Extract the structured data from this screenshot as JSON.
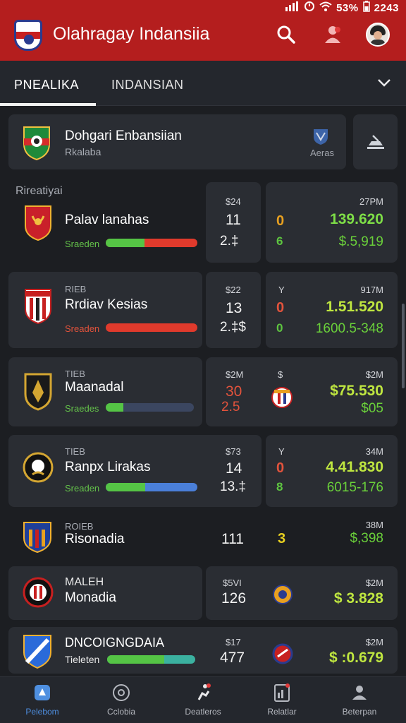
{
  "status_bar": {
    "battery": "53%",
    "time": "2243"
  },
  "app": {
    "title": "Olahragay Indansiia"
  },
  "tabs": [
    {
      "label": "PNEALIKA"
    },
    {
      "label": "INDANSIAN"
    }
  ],
  "featured": {
    "title": "Dohgari Enbansiian",
    "subtitle": "Rkalaba",
    "badge_label": "Aeras"
  },
  "section_label": "Rireatiyai",
  "rows": [
    {
      "name": "Palav lanahas",
      "small": "",
      "bar_label": "Sraeden",
      "bar": [
        0.42,
        0.58
      ],
      "count_top": "$24",
      "count": "11",
      "count_bottom": "2.‡",
      "mid_top": "",
      "mid_icon": "0",
      "mid_bottom": "6",
      "val_top": "27PM",
      "value": "139.620",
      "value2": "$.5,919"
    },
    {
      "name": "Rrdiav Kesias",
      "small": "RIEB",
      "bar_label": "Sreaden",
      "bar": [
        0.0,
        1.0
      ],
      "count_top": "$22",
      "count": "13",
      "count_bottom": "2.‡$",
      "mid_top": "Y",
      "mid_icon": "0",
      "mid_bottom": "0",
      "val_top": "917M",
      "value": "1.51.520",
      "value2": "1600.5-348"
    },
    {
      "name": "Maanadal",
      "small": "TIEB",
      "bar_label": "Sraedes",
      "bar": [
        0.2,
        0.0
      ],
      "count_top": "$2M",
      "count": "30",
      "count_bottom": "2.5",
      "mid_top": "$",
      "mid_icon": "",
      "mid_bottom": "",
      "val_top": "$2M",
      "value": "$75.530",
      "value2": "$05"
    },
    {
      "name": "Ranpx Lirakas",
      "small": "TIEB",
      "bar_label": "Sreaden",
      "bar": [
        0.43,
        0.57
      ],
      "count_top": "$73",
      "count": "14",
      "count_bottom": "13.‡",
      "mid_top": "Y",
      "mid_icon": "0",
      "mid_bottom": "8",
      "val_top": "34M",
      "value": "4.41.830",
      "value2": "6015-176"
    },
    {
      "name": "Risonadia",
      "small": "ROIEB",
      "bar_label": "",
      "bar": [
        0,
        0
      ],
      "count_top": "",
      "count": "111",
      "count_bottom": "",
      "mid_top": "",
      "mid_icon": "3",
      "mid_bottom": "",
      "val_top": "38M",
      "value": "",
      "value2": "$,398"
    },
    {
      "name": "Monadia",
      "small": "MALEH",
      "bar_label": "",
      "bar": [
        0,
        0
      ],
      "count_top": "$5VI",
      "count": "126",
      "count_bottom": "",
      "mid_top": "",
      "mid_icon": "",
      "mid_bottom": "",
      "val_top": "$2M",
      "value": "",
      "value2": "$ 3.828"
    },
    {
      "name": "DNCOIGNGDAIA",
      "small": "",
      "bar_label": "Tieleten",
      "bar": [
        0.65,
        0.35
      ],
      "count_top": "$17",
      "count": "477",
      "count_bottom": "",
      "mid_top": "",
      "mid_icon": "",
      "mid_bottom": "",
      "val_top": "$2M",
      "value": "",
      "value2": "$ :0.679"
    }
  ],
  "bottom_nav": [
    {
      "label": "Pelebom"
    },
    {
      "label": "Cclobia"
    },
    {
      "label": "Deatleros"
    },
    {
      "label": "Relatlar"
    },
    {
      "label": "Beterpan"
    }
  ],
  "colors": {
    "appbar": "#b41e1e",
    "accent_green": "#7ede47",
    "accent_red": "#e2533c",
    "bar_blue": "#4a7fd9",
    "nav_active": "#4e8fe0"
  }
}
